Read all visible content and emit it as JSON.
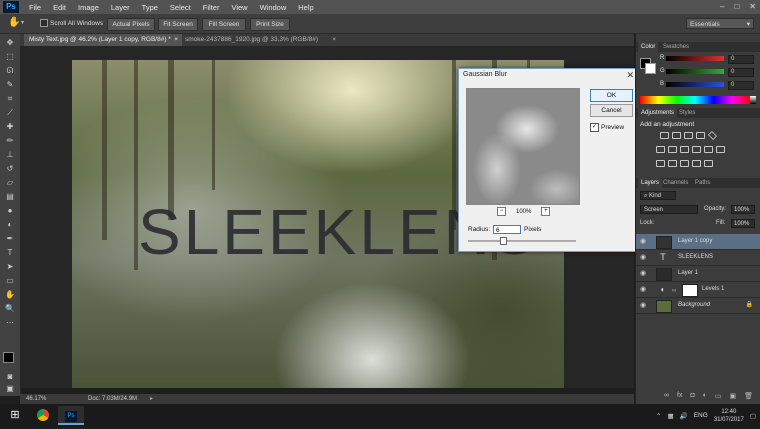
{
  "app": {
    "logo": "Ps"
  },
  "menu": [
    "File",
    "Edit",
    "Image",
    "Layer",
    "Type",
    "Select",
    "Filter",
    "View",
    "Window",
    "Help"
  ],
  "window_controls": [
    "–",
    "□",
    "✕"
  ],
  "options_bar": {
    "scroll_all": "Scroll All Windows",
    "buttons": [
      "Actual Pixels",
      "Fit Screen",
      "Fill Screen",
      "Print Size"
    ],
    "workspace": "Essentials"
  },
  "tabs": [
    {
      "label": "Misty Text.jpg @ 46.2% (Layer 1 copy, RGB/8#) *",
      "close": "×"
    },
    {
      "label": "smoke-2437886_1920.jpg @ 33.3% (RGB/8#)",
      "close": "×"
    }
  ],
  "canvas": {
    "text": "SLEEKLENS"
  },
  "status": {
    "zoom": "46.17%",
    "doc": "Doc: 7.03M/24.9M"
  },
  "dialog": {
    "title": "Gaussian Blur",
    "close": "✕",
    "ok": "OK",
    "cancel": "Cancel",
    "preview_label": "Preview",
    "preview_checked": true,
    "zoom": "100%",
    "zoom_minus": "−",
    "zoom_plus": "+",
    "radius_label": "Radius:",
    "radius_value": "6",
    "radius_unit": "Pixels",
    "radius_slider_position": 0.3
  },
  "color_panel": {
    "tabs": [
      "Color",
      "Swatches"
    ],
    "channels": [
      {
        "label": "R",
        "value": "0",
        "color": "#e03030"
      },
      {
        "label": "G",
        "value": "0",
        "color": "#30b030"
      },
      {
        "label": "B",
        "value": "0",
        "color": "#3050e0"
      }
    ]
  },
  "adjustments_panel": {
    "tabs": [
      "Adjustments",
      "Styles"
    ],
    "heading": "Add an adjustment"
  },
  "layers_panel": {
    "tabs": [
      "Layers",
      "Channels",
      "Paths"
    ],
    "kind_label": "Kind",
    "blend_mode": "Screen",
    "opacity_label": "Opacity:",
    "opacity_value": "100%",
    "lock_label": "Lock:",
    "fill_label": "Fill:",
    "fill_value": "100%",
    "layers": [
      {
        "name": "Layer 1 copy",
        "type": "image",
        "selected": true
      },
      {
        "name": "SLEEKLENS",
        "type": "text",
        "selected": false
      },
      {
        "name": "Layer 1",
        "type": "image",
        "selected": false
      },
      {
        "name": "Levels 1",
        "type": "adjustment",
        "selected": false
      },
      {
        "name": "Background",
        "type": "image",
        "selected": false
      }
    ],
    "bottom_icons": [
      "link-icon",
      "fx-icon",
      "mask-icon",
      "adjustment-icon",
      "folder-icon",
      "new-layer-icon",
      "trash-icon"
    ]
  },
  "taskbar": {
    "language": "ENG",
    "time": "12:40",
    "date": "31/07/2017"
  }
}
